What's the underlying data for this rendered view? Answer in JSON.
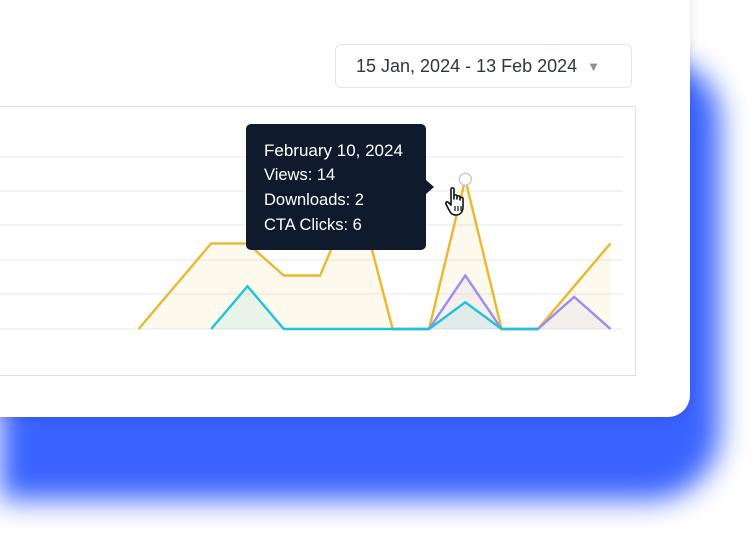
{
  "date_range": {
    "label": "15 Jan, 2024 - 13 Feb 2024",
    "caret": "▼"
  },
  "tooltip": {
    "date": "February 10, 2024",
    "views": "Views: 14",
    "downloads": "Downloads: 2",
    "cta_clicks": "CTA Clicks: 6"
  },
  "colors": {
    "views": "#eab830",
    "downloads": "#9a8cf0",
    "cta_clicks": "#20c3d8",
    "tooltip_bg": "#0f1a2c",
    "shadow": "#2f5bff"
  },
  "chart_data": {
    "type": "area",
    "ylim": [
      0,
      16
    ],
    "grid": true,
    "series": [
      {
        "key": "views",
        "x": [
          2,
          4,
          5,
          6,
          7,
          8,
          9,
          10,
          11,
          12,
          13,
          14,
          15
        ],
        "values": [
          0,
          8,
          8,
          5,
          5,
          13,
          0,
          0,
          14,
          0,
          0,
          4,
          8
        ]
      },
      {
        "key": "downloads",
        "x": [
          9,
          10,
          11,
          12,
          13,
          14,
          15
        ],
        "values": [
          0,
          0,
          5,
          0,
          0,
          3,
          0
        ]
      },
      {
        "key": "cta_clicks",
        "x": [
          4,
          5,
          6,
          7,
          8,
          9,
          10,
          11,
          12,
          13
        ],
        "values": [
          0,
          4,
          0,
          0,
          0,
          0,
          0,
          2.5,
          0,
          0
        ]
      }
    ],
    "highlight": {
      "series": "views",
      "x": 11
    }
  }
}
